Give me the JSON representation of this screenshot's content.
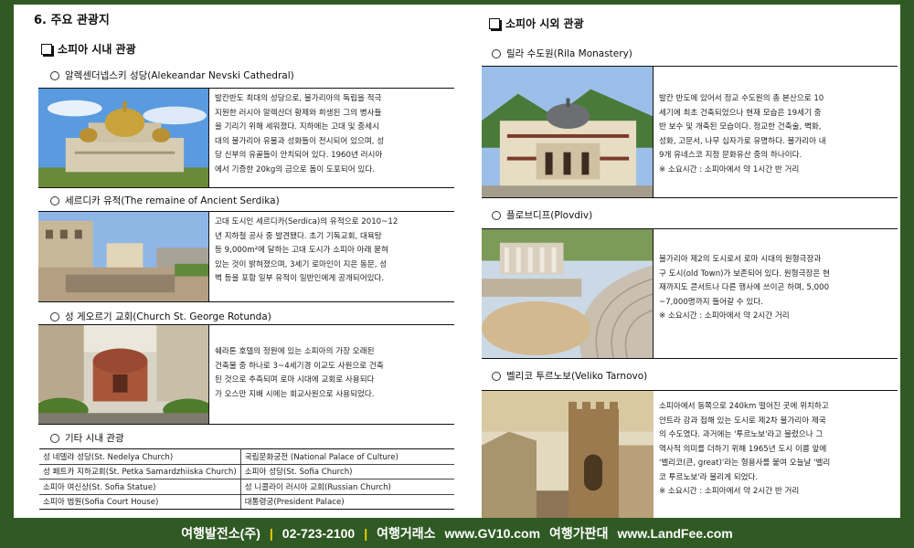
{
  "section_title": "6. 주요 관광지",
  "left": {
    "heading": "소피아 시내 관광",
    "entries": [
      {
        "title": "알렉센더넵스키 성당(Alekeandar Nevski Cathedral)",
        "lines": [
          "발칸반도 최대의 성당으로, 불가리아의 독립을 적극",
          "지원한 러시아 알렉산더 황제와 희생된 그의 병사들",
          "을 기리기 위해 세워졌다. 지하에는 고대 및 중세시",
          "대의 불가리아 유물과 성화들이 전시되어 있으며, 성",
          "당 신부의 유골들이 안치되어 있다. 1960년 러시아",
          "에서 기증한 20kg의 금으로 돔이 도포되어 있다."
        ]
      },
      {
        "title": "세르디카 유적(The remaine of Ancient Serdika)",
        "lines": [
          "고대 도시인 세르디카(Serdica)의 유적으로 2010~12",
          "년 지하철 공사 중 발견됐다. 초기 기독교회, 대욕탕",
          "등 9,000m²에 달하는 고대 도시가 소피아 아래 묻혀",
          "있는 것이 밝혀졌으며, 3세기 로마인이 지은 동문, 성",
          "벽 등을 포함 일부 유적이 일반인에게 공개되어있다."
        ]
      },
      {
        "title": "성 게오르기 교회(Church St. George Rotunda)",
        "lines": [
          "쉐라톤 호텔의 정원에 있는 소피아의 가장 오래된",
          "건축물 중 하나로 3~4세기경 이교도 사원으로 건축",
          "된 것으로 추측되며 로마 시대에 교회로 사용되다",
          "가 오스만 지배 시에는 회교사원으로 사용되었다."
        ]
      }
    ],
    "misc_title": "기타 시내 관광",
    "misc_rows": [
      [
        "성 네델랴 성당(St. Nedelya Church)",
        "국립문화궁전 (National Palace of Culture)"
      ],
      [
        "성 페트카 지하교회(St. Petka Samardzhiiska Church)",
        "소피아 성당(St. Sofia Church)"
      ],
      [
        "소피아 여신상(St. Sofia Statue)",
        "성 니콜라이 러시아 교회(Russian Church)"
      ],
      [
        "소피아 법원(Sofia Court House)",
        "대통령궁(President Palace)"
      ]
    ]
  },
  "right": {
    "heading": "소피아 시외 관광",
    "entries": [
      {
        "title": "릴라 수도원(Rila Monastery)",
        "lines": [
          "발칸 반도에 있어서 정교 수도원의 총 본산으로 10",
          "세기에 최초 건축되었으나 현재 모습은 19세기 중",
          "반 보수 및 개축된 모습이다. 정교한 건축술, 벽화,",
          "성화, 고문서, 나무 십자가로 유명하다. 불가리아 내",
          "9개 유네스코 지정 문화유산 중의 하나이다."
        ],
        "note": "※ 소요시간 : 소피아에서 약 1시간 반 거리"
      },
      {
        "title": "플로브디프(Plovdiv)",
        "lines": [
          "불가리아 제2의 도시로서 로마 시대의 원형극장과",
          "구 도시(old Town)가 보존되어 있다. 원형극장은 현",
          "재까지도 콘서트나 다른 행사에 쓰이곤 하며, 5,000",
          "~7,000명까지 들어갈 수 있다."
        ],
        "note": "※ 소요시간 : 소피아에서 약 2시간 거리"
      },
      {
        "title": "벨리코 투르노보(Veliko Tarnovo)",
        "lines": [
          "소피아에서 동쪽으로 240km 떨어진 곳에 위치하고",
          "얀트라 강과 접해 있는 도시로 제2차 불가리아 제국",
          "의 수도였다. 과거에는 '투르노보'라고 불렸으나 그",
          "역사적 의미를 더하기 위해 1965년 도시 이름 앞에",
          "'벨리코(큰, great)'라는 형용사를 붙여 오늘날 '벨리",
          "코 투르노보'라 불리게 되었다."
        ],
        "note": "※ 소요시간 : 소피아에서 약 2시간 반 거리"
      }
    ]
  },
  "footer": {
    "company": "여행발전소(주)",
    "phone": "02-723-2100",
    "exchange": "여행거래소",
    "site1": "www.GV10.com",
    "board": "여행가판대",
    "site2": "www.LandFee.com",
    "separator": "|"
  }
}
